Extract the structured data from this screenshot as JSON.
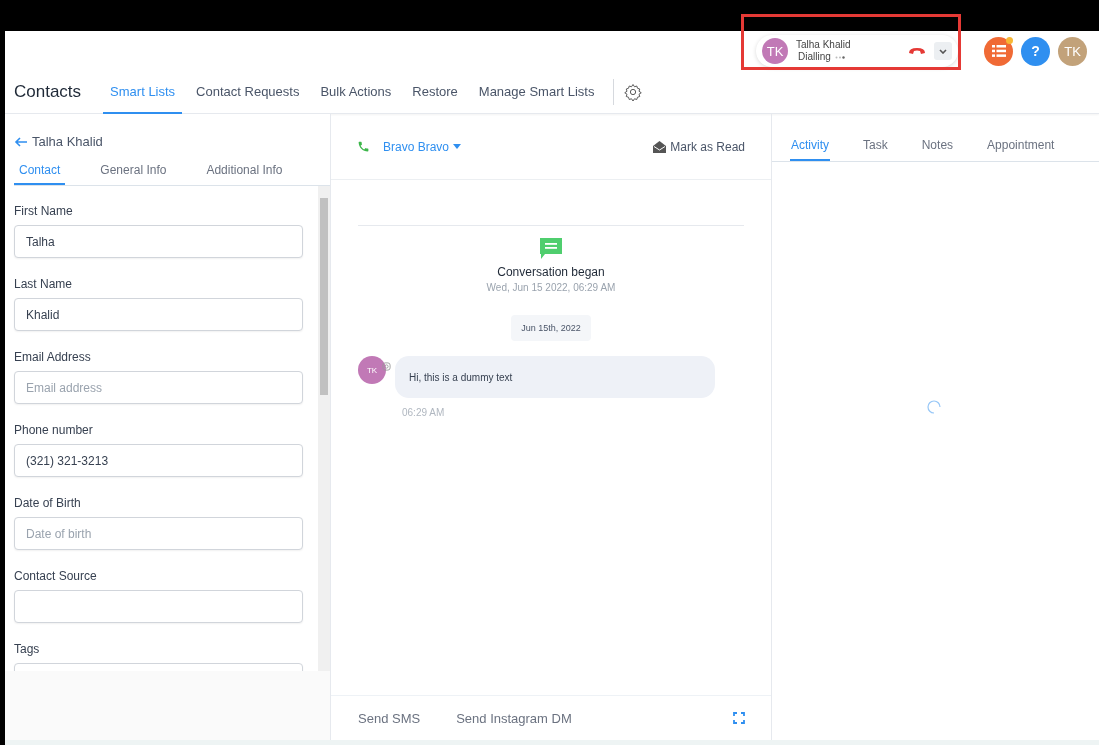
{
  "call_widget": {
    "initials": "TK",
    "name": "Talha Khalid",
    "status": "Dialling",
    "highlighted": true
  },
  "header_avatars": [
    {
      "kind": "tasks",
      "color": "#f06a35",
      "badge": true
    },
    {
      "kind": "help",
      "text": "?",
      "color": "#2f8ff0"
    },
    {
      "kind": "user",
      "text": "TK",
      "color": "#c2a27a"
    }
  ],
  "nav": {
    "title": "Contacts",
    "tabs": [
      {
        "label": "Smart Lists",
        "selected": true
      },
      {
        "label": "Contact Requests",
        "selected": false
      },
      {
        "label": "Bulk Actions",
        "selected": false
      },
      {
        "label": "Restore",
        "selected": false
      },
      {
        "label": "Manage Smart Lists",
        "selected": false
      }
    ]
  },
  "contact_panel": {
    "back_label": "Talha Khalid",
    "tabs": [
      {
        "label": "Contact",
        "selected": true
      },
      {
        "label": "General Info",
        "selected": false
      },
      {
        "label": "Additional Info",
        "selected": false
      }
    ],
    "fields": [
      {
        "label": "First Name",
        "value": "Talha"
      },
      {
        "label": "Last Name",
        "value": "Khalid"
      },
      {
        "label": "Email Address",
        "placeholder": "Email address"
      },
      {
        "label": "Phone number",
        "value": "(321) 321-3213"
      },
      {
        "label": "Date of Birth",
        "placeholder": "Date of birth"
      },
      {
        "label": "Contact Source"
      },
      {
        "label": "Tags"
      }
    ]
  },
  "conversation": {
    "contact": "Bravo Bravo",
    "mark_read": "Mark as Read",
    "began_title": "Conversation began",
    "began_time": "Wed, Jun 15 2022, 06:29 AM",
    "date_chip": "Jun 15th, 2022",
    "messages": [
      {
        "initials": "TK",
        "text": "Hi, this is a dummy text",
        "time": "06:29 AM"
      }
    ],
    "composer_tabs": [
      {
        "label": "Send SMS",
        "selected": false
      },
      {
        "label": "Send Instagram DM",
        "selected": false
      }
    ]
  },
  "activity_panel": {
    "tabs": [
      {
        "label": "Activity",
        "selected": true
      },
      {
        "label": "Task",
        "selected": false
      },
      {
        "label": "Notes",
        "selected": false
      },
      {
        "label": "Appointment",
        "selected": false
      }
    ],
    "loading": true
  }
}
